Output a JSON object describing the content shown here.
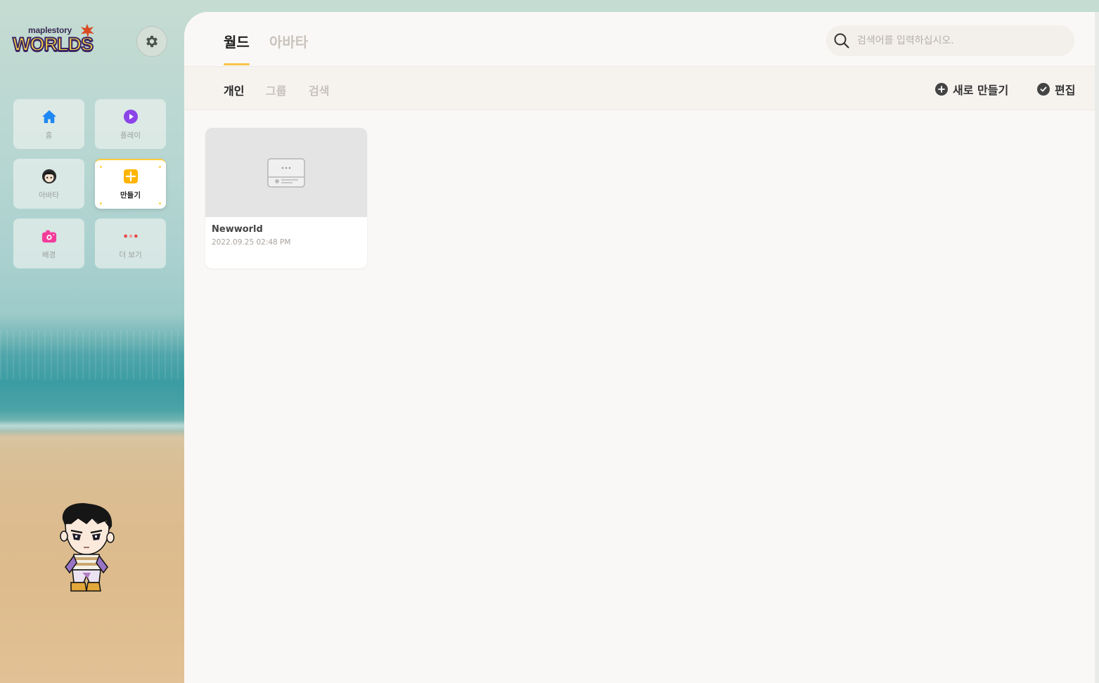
{
  "app": {
    "logo_small": "maplestory",
    "logo_big": "WORLDS"
  },
  "sidebar": {
    "items": [
      {
        "label": "홈",
        "icon": "home-icon",
        "color": "#1e88f5"
      },
      {
        "label": "플레이",
        "icon": "play-icon",
        "color": "#8b44e8"
      },
      {
        "label": "아바타",
        "icon": "avatar-icon",
        "color": "#333333"
      },
      {
        "label": "만들기",
        "icon": "create-icon",
        "color": "#ffb400",
        "active": true
      },
      {
        "label": "배경",
        "icon": "camera-icon",
        "color": "#f23c9a"
      },
      {
        "label": "더 보기",
        "icon": "more-icon",
        "color": "#e84a4a"
      }
    ]
  },
  "header": {
    "tabs": [
      {
        "label": "월드",
        "active": true
      },
      {
        "label": "아바타",
        "active": false
      }
    ],
    "search": {
      "placeholder": "검색어를 입력하십시오."
    }
  },
  "subheader": {
    "tabs": [
      {
        "label": "개인",
        "active": true
      },
      {
        "label": "그룹",
        "active": false
      },
      {
        "label": "검색",
        "active": false
      }
    ],
    "actions": {
      "new_label": "새로 만들기",
      "edit_label": "편집"
    }
  },
  "worlds": [
    {
      "name": "Newworld",
      "date": "2022.09.25 02:48 PM"
    }
  ],
  "colors": {
    "accent": "#f7c348",
    "panel_bg": "#faf8f6"
  }
}
